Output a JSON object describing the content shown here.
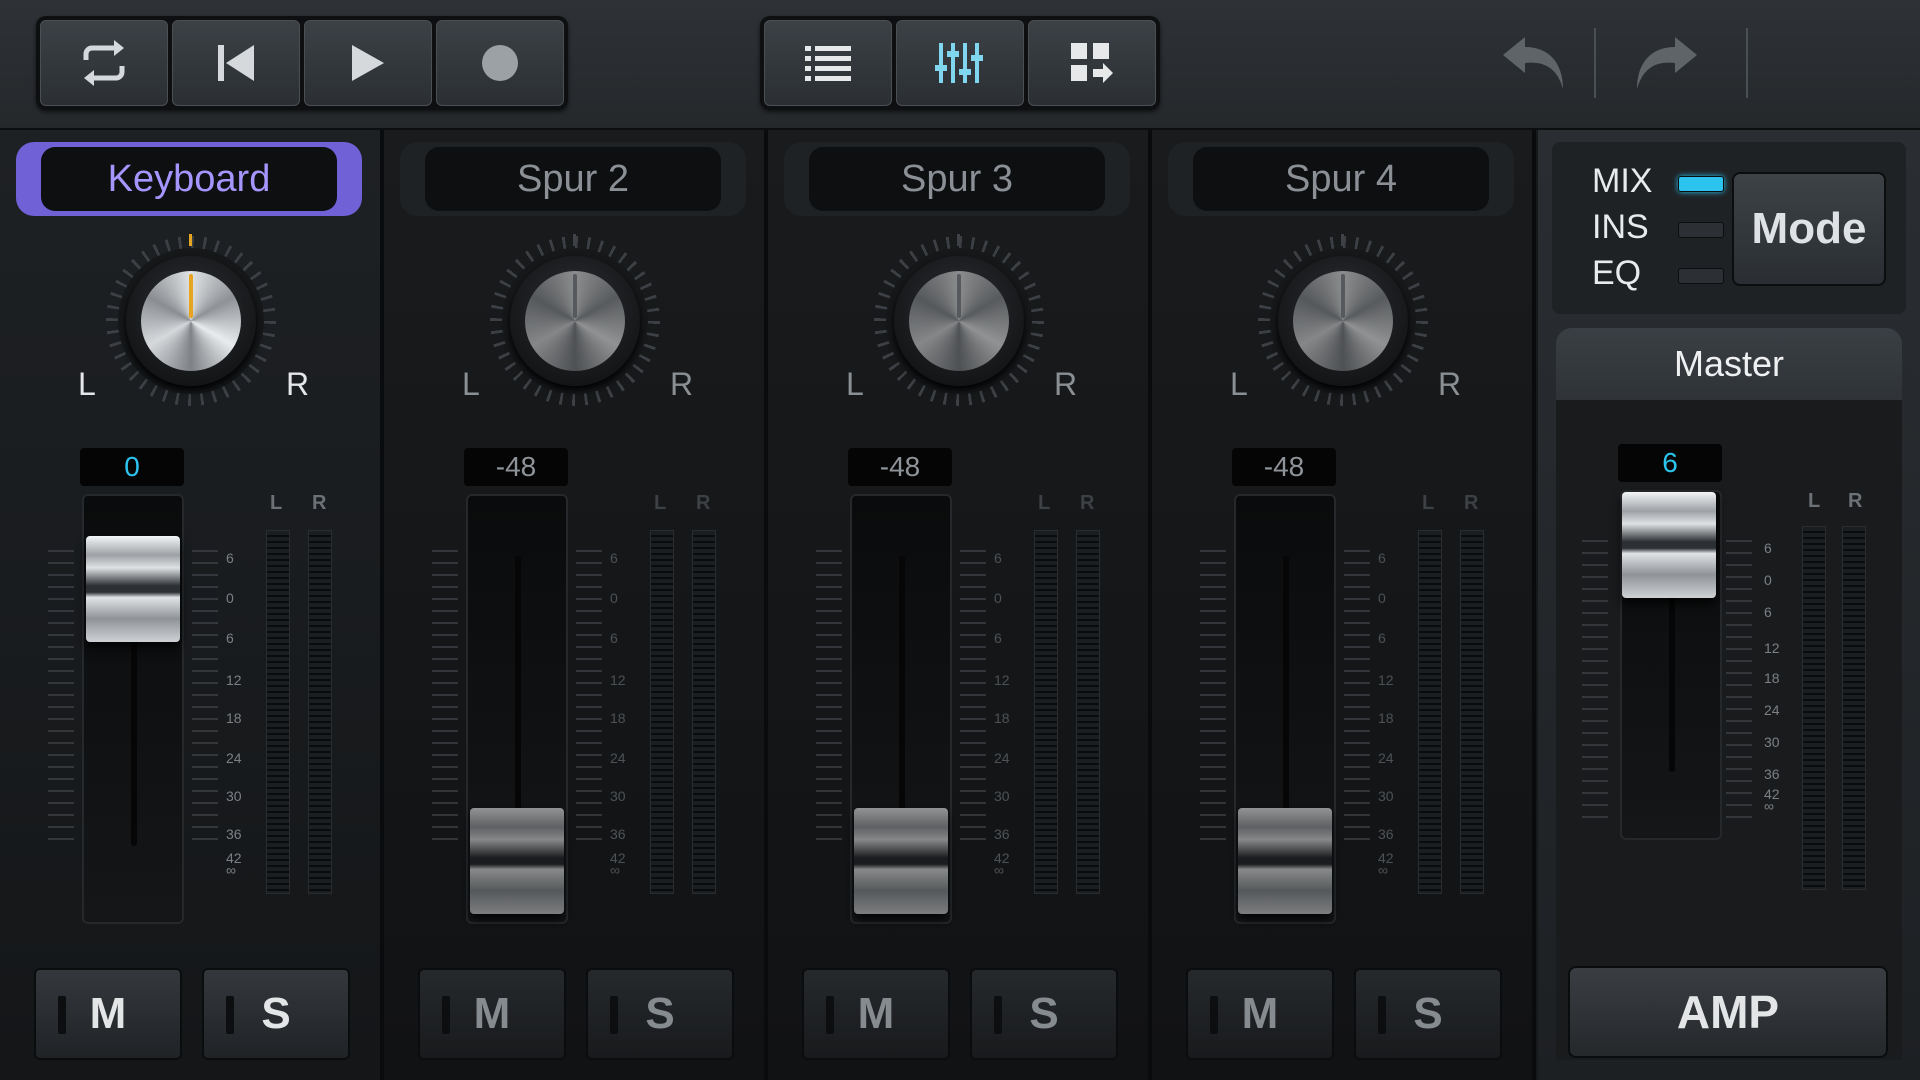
{
  "toolbar": {
    "transport": [
      {
        "name": "loop-icon"
      },
      {
        "name": "skip-back-icon"
      },
      {
        "name": "play-icon"
      },
      {
        "name": "record-icon"
      }
    ],
    "views": [
      {
        "name": "list-icon"
      },
      {
        "name": "mixer-icon"
      },
      {
        "name": "grid-icon"
      }
    ],
    "undo_icon": "undo-icon",
    "redo_icon": "redo-icon"
  },
  "channels": [
    {
      "name": "Keyboard",
      "active": true,
      "volume": "0",
      "pan_left": "L",
      "pan_right": "R",
      "mute": "M",
      "solo": "S"
    },
    {
      "name": "Spur 2",
      "active": false,
      "volume": "-48",
      "pan_left": "L",
      "pan_right": "R",
      "mute": "M",
      "solo": "S"
    },
    {
      "name": "Spur 3",
      "active": false,
      "volume": "-48",
      "pan_left": "L",
      "pan_right": "R",
      "mute": "M",
      "solo": "S"
    },
    {
      "name": "Spur 4",
      "active": false,
      "volume": "-48",
      "pan_left": "L",
      "pan_right": "R",
      "mute": "M",
      "solo": "S"
    }
  ],
  "scale": [
    "6",
    "0",
    "6",
    "12",
    "18",
    "24",
    "30",
    "36",
    "42",
    "∞"
  ],
  "meter_labels": {
    "left": "L",
    "right": "R"
  },
  "mode": {
    "options": [
      {
        "label": "MIX",
        "on": true
      },
      {
        "label": "INS",
        "on": false
      },
      {
        "label": "EQ",
        "on": false
      }
    ],
    "button": "Mode"
  },
  "master": {
    "title": "Master",
    "volume": "6",
    "amp_button": "AMP"
  },
  "colors": {
    "accent_blue": "#2cc4ee",
    "active_purple": "#7161d6",
    "knob_marker": "#e6a521"
  }
}
